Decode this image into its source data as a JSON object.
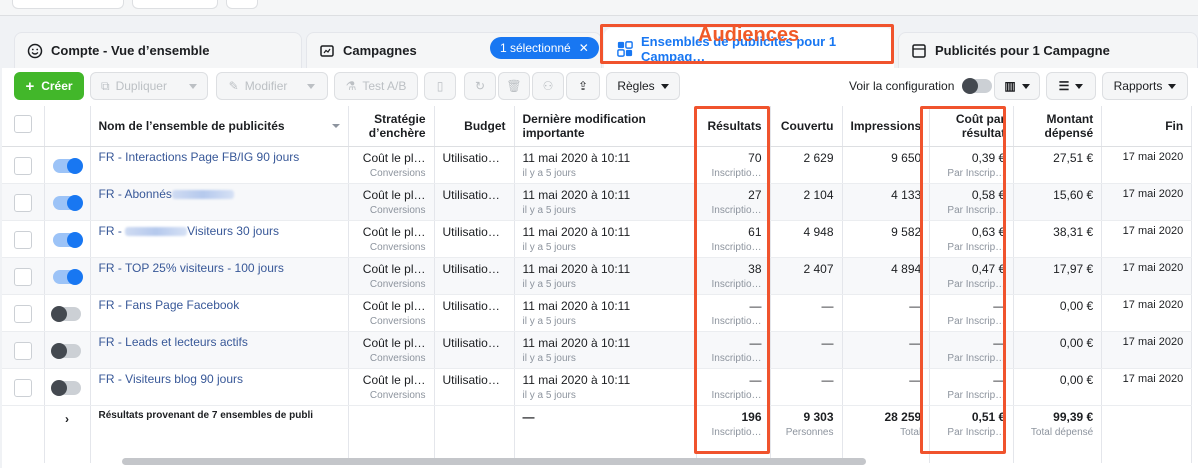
{
  "annotation": {
    "label": "Audiences",
    "color": "#f05a28"
  },
  "tabs": [
    {
      "label": "Compte - Vue d’ensemble",
      "icon": "smiley-icon"
    },
    {
      "label": "Campagnes",
      "icon": "folder-icon"
    },
    {
      "label": "Ensembles de publicités pour 1 Campag…",
      "icon": "grid-icon",
      "active": true
    },
    {
      "label": "Publicités pour 1 Campagne",
      "icon": "ad-page-icon"
    }
  ],
  "selection_pill": {
    "label": "1 sélectionné"
  },
  "toolbar": {
    "create": "Créer",
    "duplicate": "Dupliquer",
    "edit": "Modifier",
    "ab_test": "Test A/B",
    "rules": "Règles",
    "view_config": "Voir la configuration",
    "reports": "Rapports"
  },
  "columns": {
    "name": "Nom de l’ensemble de publicités",
    "bid_strategy": "Stratégie d’enchère",
    "budget": "Budget",
    "last_edit": "Dernière modification importante",
    "results": "Résultats",
    "reach": "Couvertu",
    "impressions": "Impressions",
    "cost_per_result": "Coût par résultat",
    "amount_spent": "Montant dépensé",
    "end": "Fin"
  },
  "rows": [
    {
      "on": true,
      "name": "FR - Interactions Page FB/IG 90 jours",
      "blur": 0,
      "bid": "Coût le pl…",
      "bid_sub": "Conversions",
      "budget": "Utilisatio…",
      "edit": "11 mai 2020 à 10:11",
      "edit_sub": "il y a 5 jours",
      "results": "70",
      "results_sub": "Inscriptio…",
      "reach": "2 629",
      "impr": "9 650",
      "cpr": "0,39 €",
      "cpr_sub": "Par Inscrip…",
      "spent": "27,51 €",
      "end": "17 mai 2020"
    },
    {
      "on": true,
      "name": "FR - Abonnés",
      "blur": 62,
      "bid": "Coût le pl…",
      "bid_sub": "Conversions",
      "budget": "Utilisatio…",
      "edit": "11 mai 2020 à 10:11",
      "edit_sub": "il y a 5 jours",
      "results": "27",
      "results_sub": "Inscriptio…",
      "reach": "2 104",
      "impr": "4 133",
      "cpr": "0,58 €",
      "cpr_sub": "Par Inscrip…",
      "spent": "15,60 €",
      "end": "17 mai 2020"
    },
    {
      "on": true,
      "name": "FR - ",
      "blur": 62,
      "name_after": "Visiteurs 30 jours",
      "bid": "Coût le pl…",
      "bid_sub": "Conversions",
      "budget": "Utilisatio…",
      "edit": "11 mai 2020 à 10:11",
      "edit_sub": "il y a 5 jours",
      "results": "61",
      "results_sub": "Inscriptio…",
      "reach": "4 948",
      "impr": "9 582",
      "cpr": "0,63 €",
      "cpr_sub": "Par Inscrip…",
      "spent": "38,31 €",
      "end": "17 mai 2020"
    },
    {
      "on": true,
      "name": "FR - TOP 25% visiteurs - 100 jours",
      "blur": 0,
      "bid": "Coût le pl…",
      "bid_sub": "Conversions",
      "budget": "Utilisatio…",
      "edit": "11 mai 2020 à 10:11",
      "edit_sub": "il y a 5 jours",
      "results": "38",
      "results_sub": "Inscriptio…",
      "reach": "2 407",
      "impr": "4 894",
      "cpr": "0,47 €",
      "cpr_sub": "Par Inscrip…",
      "spent": "17,97 €",
      "end": "17 mai 2020"
    },
    {
      "on": false,
      "name": "FR - Fans Page Facebook",
      "blur": 0,
      "bid": "Coût le pl…",
      "bid_sub": "Conversions",
      "budget": "Utilisatio…",
      "edit": "11 mai 2020 à 10:11",
      "edit_sub": "il y a 5 jours",
      "results": "—",
      "results_sub": "Inscriptio…",
      "reach": "—",
      "impr": "—",
      "cpr": "—",
      "cpr_sub": "Par Inscrip…",
      "spent": "0,00 €",
      "end": "17 mai 2020"
    },
    {
      "on": false,
      "name": "FR - Leads et lecteurs actifs",
      "blur": 0,
      "bid": "Coût le pl…",
      "bid_sub": "Conversions",
      "budget": "Utilisatio…",
      "edit": "11 mai 2020 à 10:11",
      "edit_sub": "il y a 5 jours",
      "results": "—",
      "results_sub": "Inscriptio…",
      "reach": "—",
      "impr": "—",
      "cpr": "—",
      "cpr_sub": "Par Inscrip…",
      "spent": "0,00 €",
      "end": "17 mai 2020"
    },
    {
      "on": false,
      "name": "FR - Visiteurs blog 90 jours",
      "blur": 0,
      "bid": "Coût le pl…",
      "bid_sub": "Conversions",
      "budget": "Utilisatio…",
      "edit": "11 mai 2020 à 10:11",
      "edit_sub": "il y a 5 jours",
      "results": "—",
      "results_sub": "Inscriptio…",
      "reach": "—",
      "impr": "—",
      "cpr": "—",
      "cpr_sub": "Par Inscrip…",
      "spent": "0,00 €",
      "end": "17 mai 2020"
    }
  ],
  "totals": {
    "label": "Résultats provenant de 7 ensembles de publi",
    "edit": "—",
    "results": "196",
    "results_sub": "Inscriptio…",
    "reach": "9 303",
    "reach_sub": "Personnes",
    "impr": "28 259",
    "impr_sub": "Total",
    "cpr": "0,51 €",
    "cpr_sub": "Par Inscrip…",
    "spent": "99,39 €",
    "spent_sub": "Total dépensé"
  }
}
